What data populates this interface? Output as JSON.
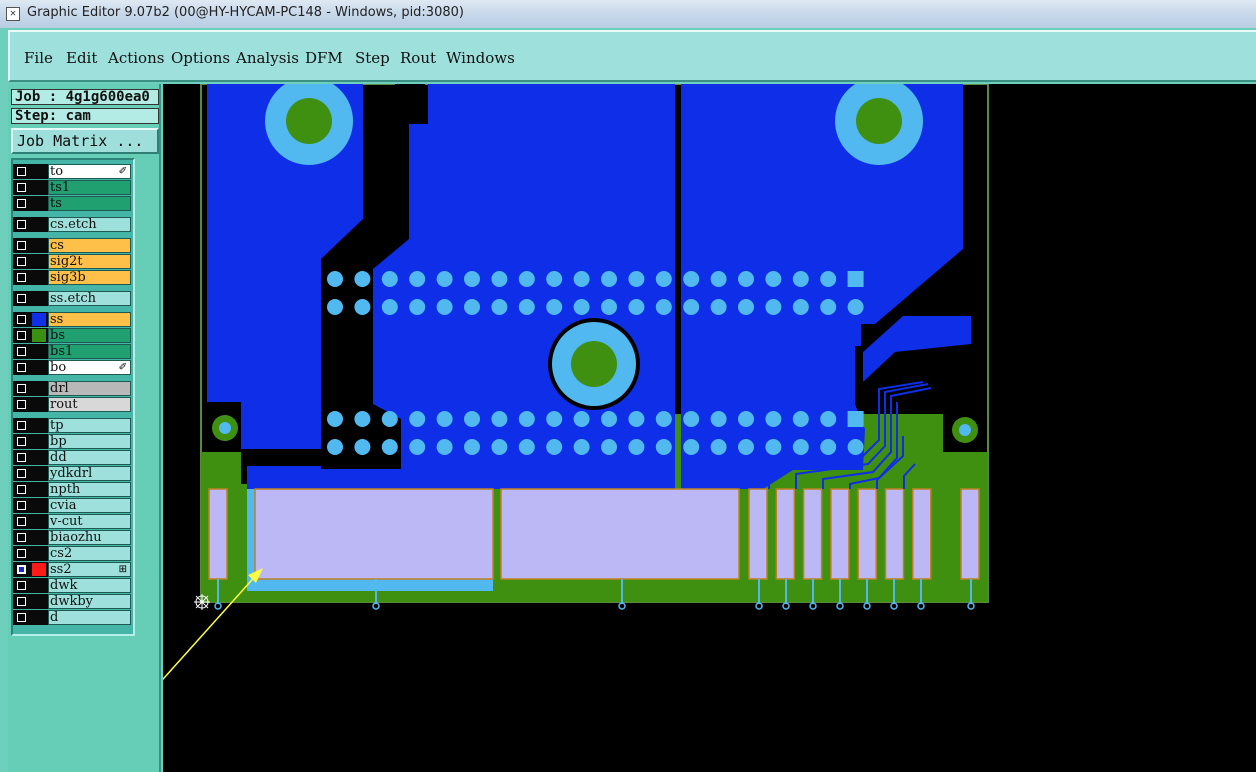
{
  "window": {
    "title": "Graphic Editor 9.07b2 (00@HY-HYCAM-PC148 - Windows, pid:3080)",
    "icon": "x-window-icon"
  },
  "menu": [
    "File",
    "Edit",
    "Actions",
    "Options",
    "Analysis",
    "DFM",
    "Step",
    "Rout",
    "Windows"
  ],
  "job": {
    "label": "Job : 4g1g600ea0"
  },
  "step": {
    "label": "Step: cam"
  },
  "job_matrix": {
    "label": "Job Matrix ..."
  },
  "layers": [
    {
      "name": "to",
      "color": "#ffffff",
      "swatch": "",
      "checked": false,
      "mark": "✐"
    },
    {
      "name": "ts1",
      "color": "#20a070",
      "swatch": "",
      "checked": false,
      "mark": ""
    },
    {
      "name": "ts",
      "color": "#20a070",
      "swatch": "",
      "checked": false,
      "mark": ""
    },
    {
      "name": "cs.etch",
      "color": "#9ee0dc",
      "swatch": "",
      "checked": false,
      "mark": ""
    },
    {
      "name": "cs",
      "color": "#ffc04a",
      "swatch": "",
      "checked": false,
      "mark": ""
    },
    {
      "name": "sig2t",
      "color": "#ffc04a",
      "swatch": "",
      "checked": false,
      "mark": ""
    },
    {
      "name": "sig3b",
      "color": "#ffc04a",
      "swatch": "",
      "checked": false,
      "mark": ""
    },
    {
      "name": "ss.etch",
      "color": "#9ee0dc",
      "swatch": "",
      "checked": false,
      "mark": ""
    },
    {
      "name": "ss",
      "color": "#ffc04a",
      "swatch": "#1030e8",
      "checked": false,
      "mark": ""
    },
    {
      "name": "bs",
      "color": "#20a070",
      "swatch": "#3a9010",
      "checked": false,
      "mark": ""
    },
    {
      "name": "bs1",
      "color": "#20a070",
      "swatch": "",
      "checked": false,
      "mark": ""
    },
    {
      "name": "bo",
      "color": "#ffffff",
      "swatch": "",
      "checked": false,
      "mark": "✐"
    },
    {
      "name": "drl",
      "color": "#b8b8b8",
      "swatch": "",
      "checked": false,
      "mark": ""
    },
    {
      "name": "rout",
      "color": "#d8d8d8",
      "swatch": "",
      "checked": false,
      "mark": ""
    },
    {
      "name": "tp",
      "color": "#9ee0dc",
      "swatch": "",
      "checked": false,
      "mark": ""
    },
    {
      "name": "bp",
      "color": "#9ee0dc",
      "swatch": "",
      "checked": false,
      "mark": ""
    },
    {
      "name": "dd",
      "color": "#9ee0dc",
      "swatch": "",
      "checked": false,
      "mark": ""
    },
    {
      "name": "ydkdrl",
      "color": "#9ee0dc",
      "swatch": "",
      "checked": false,
      "mark": ""
    },
    {
      "name": "npth",
      "color": "#9ee0dc",
      "swatch": "",
      "checked": false,
      "mark": ""
    },
    {
      "name": "cvia",
      "color": "#9ee0dc",
      "swatch": "",
      "checked": false,
      "mark": ""
    },
    {
      "name": "v-cut",
      "color": "#9ee0dc",
      "swatch": "",
      "checked": false,
      "mark": ""
    },
    {
      "name": "biaozhu",
      "color": "#9ee0dc",
      "swatch": "",
      "checked": false,
      "mark": ""
    },
    {
      "name": "cs2",
      "color": "#9ee0dc",
      "swatch": "",
      "checked": false,
      "mark": ""
    },
    {
      "name": "ss2",
      "color": "#9ee0dc",
      "swatch": "#ff1a1a",
      "checked": true,
      "mark": "⊞"
    },
    {
      "name": "dwk",
      "color": "#9ee0dc",
      "swatch": "",
      "checked": false,
      "mark": ""
    },
    {
      "name": "dwkby",
      "color": "#9ee0dc",
      "swatch": "",
      "checked": false,
      "mark": ""
    },
    {
      "name": "d",
      "color": "#9ee0dc",
      "swatch": "",
      "checked": false,
      "mark": ""
    }
  ],
  "colors": {
    "copper_blue": "#0e2ee8",
    "pad_cyan": "#52b8f0",
    "board_green": "#3f8f10",
    "finger_lavender": "#bcb8f6",
    "outline": "#c08020",
    "annotation_arrow": "#ffff40",
    "canvas_bg": "#000000"
  }
}
